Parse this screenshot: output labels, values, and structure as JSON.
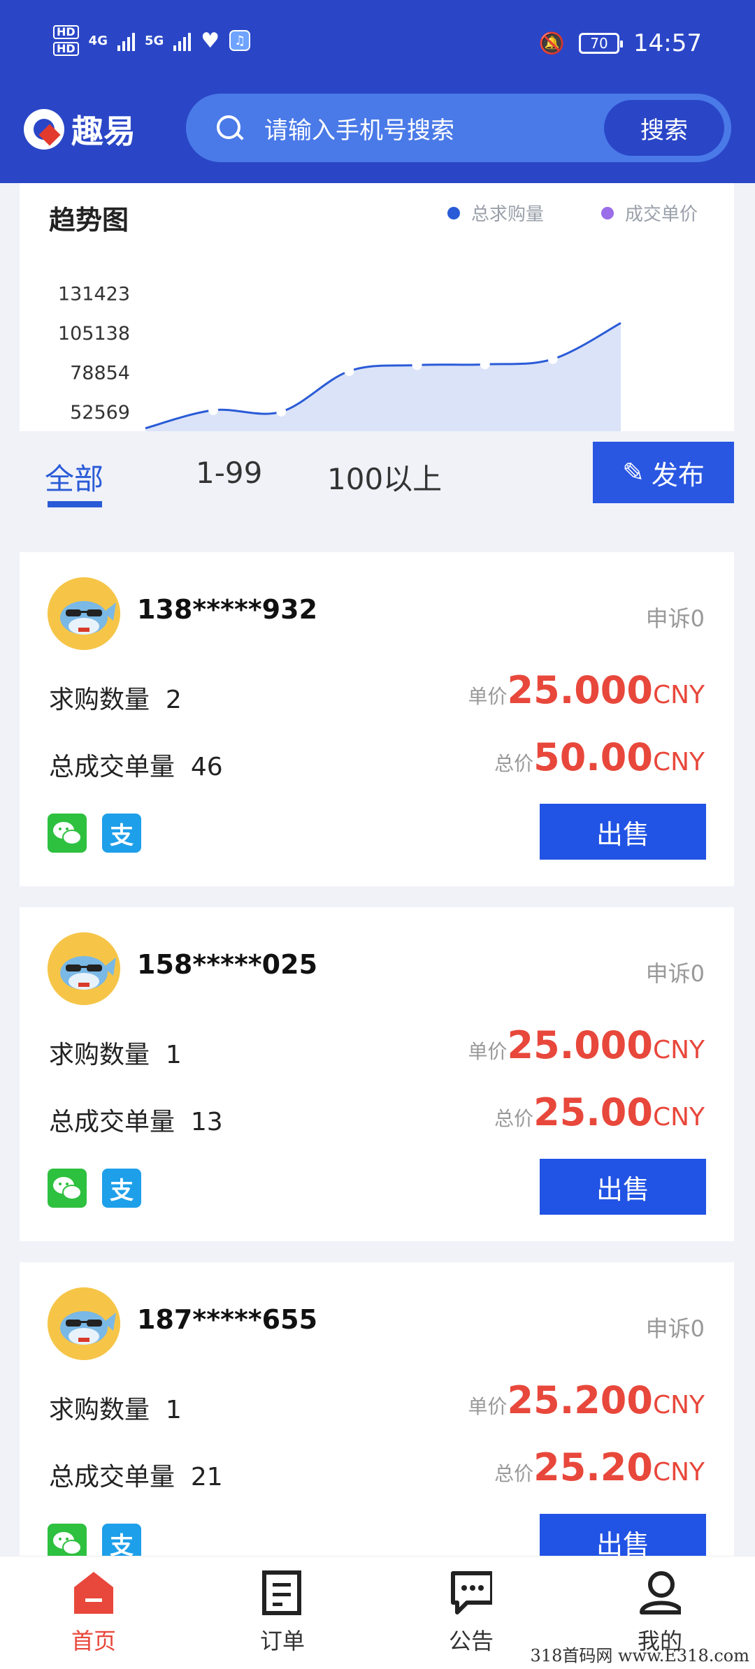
{
  "status_bar": {
    "hd1": "HD",
    "hd2": "HD",
    "net1": "4G",
    "net2": "5G",
    "battery": "70",
    "time": "14:57"
  },
  "header": {
    "logo_text": "趣易",
    "search_placeholder": "请输入手机号搜索",
    "search_button": "搜索"
  },
  "chart_data": {
    "type": "area",
    "title": "趋势图",
    "legend": [
      "总求购量",
      "成交单价"
    ],
    "legend_colors": [
      "#2a5bd7",
      "#9b6de8"
    ],
    "y_ticks": [
      "131423",
      "105138",
      "78854",
      "52569"
    ],
    "series": [
      {
        "name": "总求购量",
        "values": [
          42000,
          54000,
          53000,
          80000,
          84000,
          84500,
          88000,
          112000
        ]
      }
    ],
    "ylim": [
      40000,
      140000
    ]
  },
  "tabs": {
    "items": [
      "全部",
      "1-99",
      "100以上"
    ],
    "active": 0,
    "publish_label": "发布"
  },
  "orders": [
    {
      "phone": "138*****932",
      "complaint": "申诉0",
      "qty_label": "求购数量",
      "qty": "2",
      "total_label": "总成交单量",
      "total": "46",
      "unit_label": "单价",
      "unit_price": "25.000",
      "total_price_label": "总价",
      "total_price": "50.00",
      "currency": "CNY",
      "sell": "出售"
    },
    {
      "phone": "158*****025",
      "complaint": "申诉0",
      "qty_label": "求购数量",
      "qty": "1",
      "total_label": "总成交单量",
      "total": "13",
      "unit_label": "单价",
      "unit_price": "25.000",
      "total_price_label": "总价",
      "total_price": "25.00",
      "currency": "CNY",
      "sell": "出售"
    },
    {
      "phone": "187*****655",
      "complaint": "申诉0",
      "qty_label": "求购数量",
      "qty": "1",
      "total_label": "总成交单量",
      "total": "21",
      "unit_label": "单价",
      "unit_price": "25.200",
      "total_price_label": "总价",
      "total_price": "25.20",
      "currency": "CNY",
      "sell": "出售"
    }
  ],
  "bottom_nav": [
    {
      "label": "首页",
      "icon": "home-icon",
      "active": true
    },
    {
      "label": "订单",
      "icon": "order-icon",
      "active": false
    },
    {
      "label": "公告",
      "icon": "notice-icon",
      "active": false
    },
    {
      "label": "我的",
      "icon": "user-icon",
      "active": false
    }
  ],
  "watermark": "318首码网 www.E318.com",
  "colors": {
    "primary": "#2a46c7",
    "accent_red": "#e8473b",
    "sell_blue": "#2153e4"
  }
}
